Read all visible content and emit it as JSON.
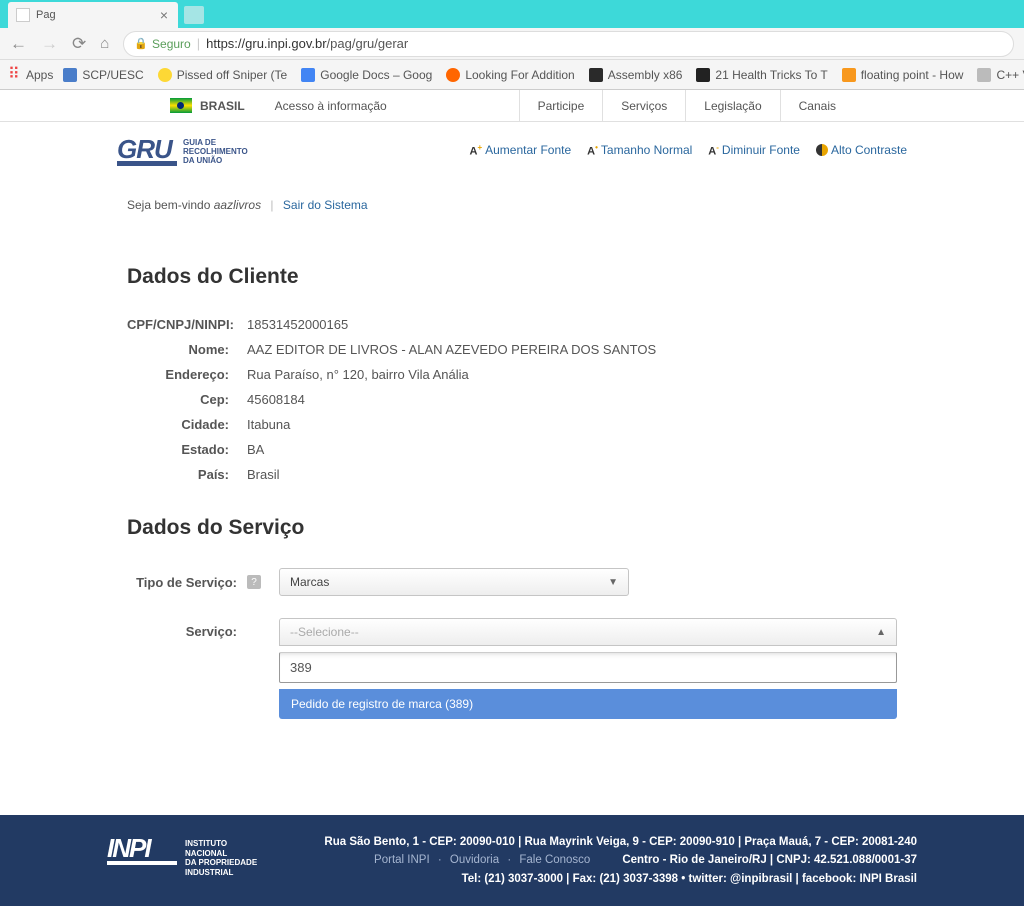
{
  "browser": {
    "tab_title": "Pag",
    "secure_label": "Seguro",
    "url_host": "https://gru.inpi.gov.br",
    "url_path": "/pag/gru/gerar",
    "apps_label": "Apps",
    "bookmarks": [
      {
        "label": "SCP/UESC"
      },
      {
        "label": "Pissed off Sniper (Te"
      },
      {
        "label": "Google Docs – Goog"
      },
      {
        "label": "Looking For Addition"
      },
      {
        "label": "Assembly x86"
      },
      {
        "label": "21 Health Tricks To T"
      },
      {
        "label": "floating point - How"
      },
      {
        "label": "C++ Variables"
      }
    ]
  },
  "govbar": {
    "brasil_label": "BRASIL",
    "info_label": "Acesso à informação",
    "links": [
      "Participe",
      "Serviços",
      "Legislação",
      "Canais"
    ]
  },
  "header": {
    "logo_main": "GRU",
    "logo_sub1": "GUIA DE",
    "logo_sub2": "RECOLHIMENTO",
    "logo_sub3": "DA UNIÃO",
    "actions": {
      "aumentar": "Aumentar Fonte",
      "normal": "Tamanho Normal",
      "diminuir": "Diminuir Fonte",
      "contraste": "Alto Contraste"
    }
  },
  "welcome": {
    "prefix": "Seja bem-vindo ",
    "user": "aazlivros",
    "logout": "Sair do Sistema"
  },
  "client": {
    "title": "Dados do Cliente",
    "labels": {
      "cpf": "CPF/CNPJ/NINPI:",
      "nome": "Nome:",
      "endereco": "Endereço:",
      "cep": "Cep:",
      "cidade": "Cidade:",
      "estado": "Estado:",
      "pais": "País:"
    },
    "values": {
      "cpf": "18531452000165",
      "nome": "AAZ EDITOR DE LIVROS - ALAN AZEVEDO PEREIRA DOS SANTOS",
      "endereco": "Rua Paraíso, n° 120, bairro Vila Anália",
      "cep": "45608184",
      "cidade": "Itabuna",
      "estado": "BA",
      "pais": "Brasil"
    }
  },
  "service": {
    "title": "Dados do Serviço",
    "tipo_label": "Tipo de Serviço:",
    "tipo_value": "Marcas",
    "servico_label": "Serviço:",
    "servico_placeholder": "--Selecione--",
    "search_value": "389",
    "option": "Pedido de registro de marca (389)"
  },
  "footer": {
    "inpi_main": "INPI",
    "inpi_sub1": "INSTITUTO",
    "inpi_sub2": "NACIONAL",
    "inpi_sub3": "DA PROPRIEDADE",
    "inpi_sub4": "INDUSTRIAL",
    "address": "Rua São Bento, 1 - CEP: 20090-010 | Rua Mayrink Veiga, 9 - CEP: 20090-910 | Praça Mauá, 7 - CEP: 20081-240",
    "links": {
      "portal": "Portal INPI",
      "ouvidoria": "Ouvidoria",
      "fale": "Fale Conosco"
    },
    "city": "Centro - Rio de Janeiro/RJ | CNPJ: 42.521.088/0001-37",
    "contact": "Tel: (21) 3037-3000 | Fax: (21) 3037-3398 • twitter: @inpibrasil | facebook: INPI Brasil"
  }
}
